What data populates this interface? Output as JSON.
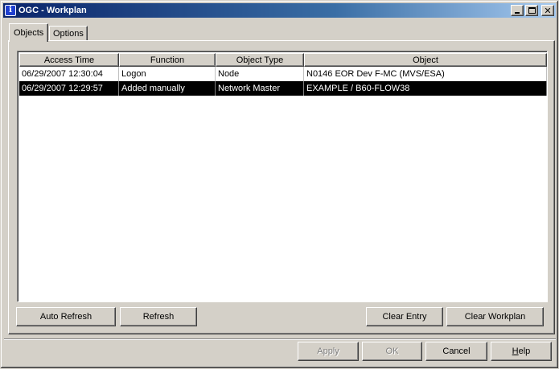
{
  "window": {
    "title": "OGC - Workplan",
    "app_icon_glyph": "i"
  },
  "tabs": [
    {
      "label": "Objects",
      "active": true
    },
    {
      "label": "Options",
      "active": false
    }
  ],
  "table": {
    "columns": [
      "Access Time",
      "Function",
      "Object Type",
      "Object"
    ],
    "rows": [
      {
        "access_time": "06/29/2007  12:30:04",
        "function": "Logon",
        "object_type": "Node",
        "object": "N0146  EOR Dev F-MC (MVS/ESA)",
        "selected": false
      },
      {
        "access_time": "06/29/2007  12:29:57",
        "function": "Added manually",
        "object_type": "Network Master",
        "object": "EXAMPLE / B60-FLOW38",
        "selected": true
      }
    ]
  },
  "panel_buttons": {
    "auto_refresh": "Auto Refresh",
    "refresh": "Refresh",
    "clear_entry": "Clear Entry",
    "clear_workplan": "Clear Workplan"
  },
  "dialog_buttons": {
    "apply": "Apply",
    "ok": "OK",
    "cancel": "Cancel",
    "help_first": "H",
    "help_rest": "elp"
  }
}
